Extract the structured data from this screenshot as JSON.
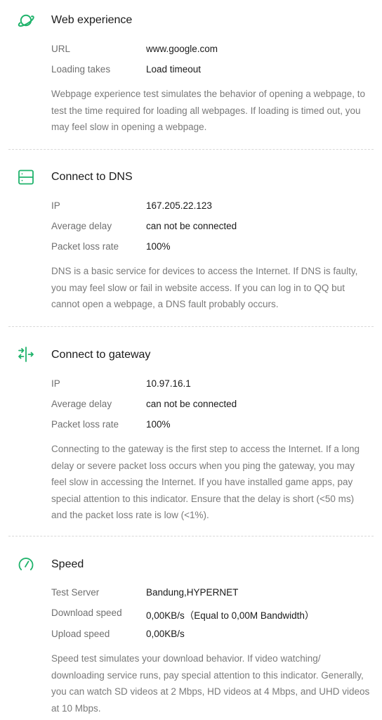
{
  "accent_color": "#1fb36b",
  "sections": [
    {
      "icon": "globe-orbit-icon",
      "title": "Web experience",
      "rows": [
        {
          "label": "URL",
          "value": "www.google.com"
        },
        {
          "label": "Loading takes",
          "value": "Load timeout"
        }
      ],
      "description": "Webpage experience test simulates the behavior of opening a webpage, to test the time required for loading all webpages. If loading is timed out, you may feel slow in opening a webpage."
    },
    {
      "icon": "dns-server-icon",
      "title": "Connect to DNS",
      "rows": [
        {
          "label": "IP",
          "value": "167.205.22.123"
        },
        {
          "label": "Average delay",
          "value": "can not be connected"
        },
        {
          "label": "Packet loss rate",
          "value": "100%"
        }
      ],
      "description": "DNS is a basic service for devices to access the Internet. If DNS is faulty, you may feel slow or fail in website access. If you can log in to QQ but cannot open a webpage, a DNS fault probably occurs."
    },
    {
      "icon": "gateway-arrows-icon",
      "title": "Connect to gateway",
      "rows": [
        {
          "label": "IP",
          "value": "10.97.16.1"
        },
        {
          "label": "Average delay",
          "value": "can not be connected"
        },
        {
          "label": "Packet loss rate",
          "value": "100%"
        }
      ],
      "description": "Connecting to the gateway is the first step to access the Internet. If a long delay or severe packet loss occurs when you ping the gateway, you may feel slow in accessing the Internet. If you have installed game apps, pay special attention to this indicator. Ensure that the delay is short (<50 ms) and the packet loss rate is low (<1%)."
    },
    {
      "icon": "speedometer-icon",
      "title": "Speed",
      "rows": [
        {
          "label": "Test Server",
          "value": "Bandung,HYPERNET"
        },
        {
          "label": "Download speed",
          "value": "0,00KB/s（Equal to 0,00M Bandwidth）"
        },
        {
          "label": "Upload speed",
          "value": "0,00KB/s"
        }
      ],
      "description": "Speed test simulates your download behavior. If video watching/ downloading service runs, pay special attention to this indicator. Generally, you can watch SD videos at 2 Mbps, HD videos at 4 Mbps, and UHD videos at 10 Mbps."
    }
  ]
}
